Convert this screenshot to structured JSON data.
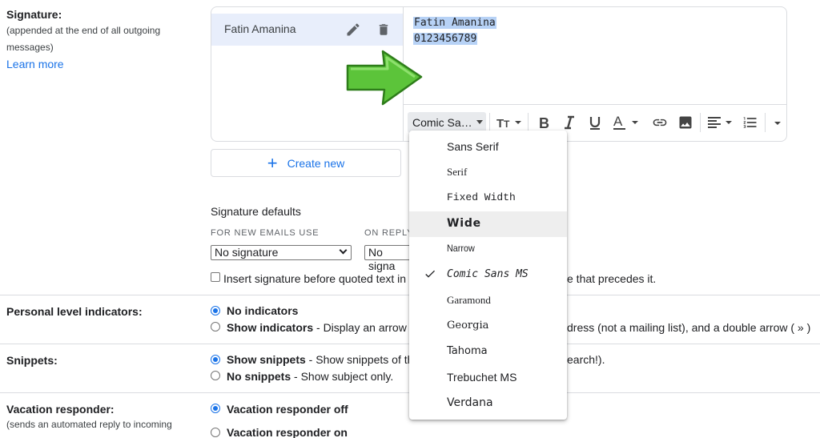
{
  "signature_section": {
    "label": "Signature:",
    "sub1": "(appended at the end of all outgoing",
    "sub2": "messages)",
    "learn_more": "Learn more",
    "signature_name": "Fatin Amanina",
    "sig_text_line1": "Fatin Amanina",
    "sig_text_line2": "0123456789",
    "create_new": "Create new"
  },
  "toolbar": {
    "font_selected": "Comic Sa…",
    "icons": [
      "text-size-icon",
      "bold-icon",
      "italic-icon",
      "underline-icon",
      "text-color-icon",
      "link-icon",
      "image-icon",
      "align-icon",
      "numbered-list-icon",
      "more-icon"
    ]
  },
  "font_menu": {
    "items": [
      "Sans Serif",
      "Serif",
      "Fixed Width",
      "Wide",
      "Narrow",
      "Comic Sans MS",
      "Garamond",
      "Georgia",
      "Tahoma",
      "Trebuchet MS",
      "Verdana"
    ],
    "selected": "Comic Sans MS",
    "highlighted": "Wide"
  },
  "defaults": {
    "title": "Signature defaults",
    "new_emails_label": "FOR NEW EMAILS USE",
    "reply_label": "ON REPLY",
    "new_emails_value": "No signature",
    "reply_value": "No signa",
    "checkbox_text_a": "Insert signature before quoted text in",
    "checkbox_text_b": "e that precedes it."
  },
  "personal_indicators": {
    "label": "Personal level indicators:",
    "opt1": "No indicators",
    "opt2_bold": "Show indicators",
    "opt2_rest": " - Display an arrow (",
    "opt2_tail": "dress (not a mailing list), and a double arrow ( » )"
  },
  "snippets": {
    "label": "Snippets:",
    "opt1_bold": "Show snippets",
    "opt1_rest": " - Show snippets of th",
    "opt1_tail": "earch!).",
    "opt2_bold": "No snippets",
    "opt2_rest": " - Show subject only."
  },
  "vacation": {
    "label": "Vacation responder:",
    "sub1": "(sends an automated reply to incoming",
    "opt1": "Vacation responder off",
    "opt2": "Vacation responder on"
  },
  "colors": {
    "accent": "#1a73e8",
    "selection": "#b7d2f6",
    "arrow_green": "#5cc43a"
  }
}
